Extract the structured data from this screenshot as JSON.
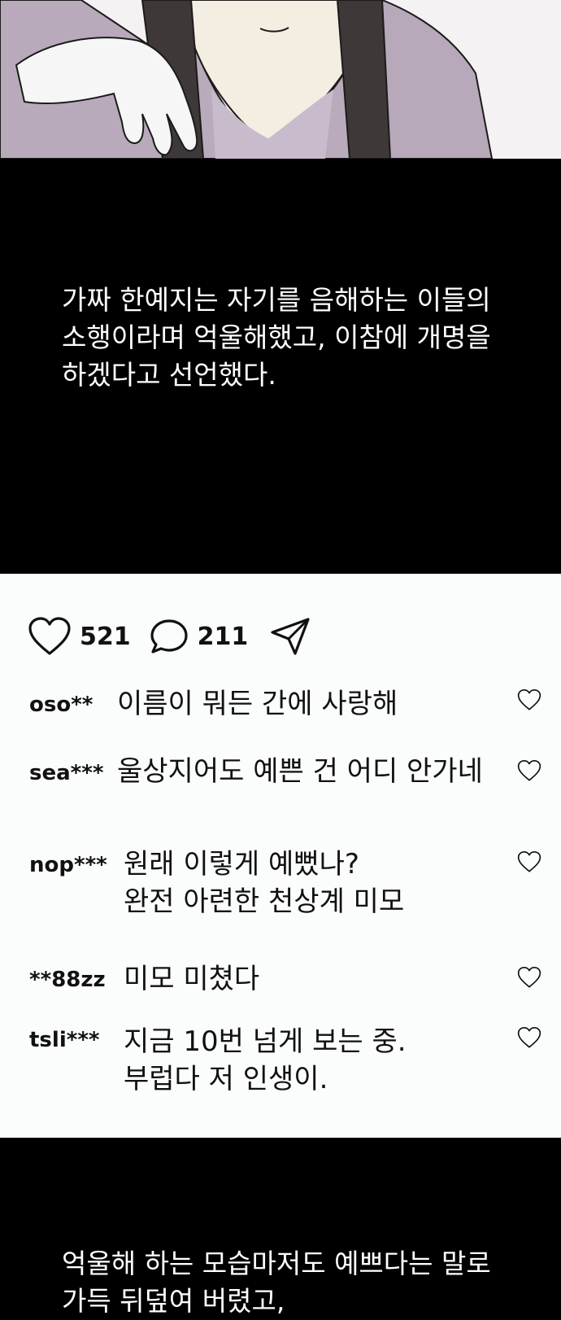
{
  "narration_1": "가짜 한예지는 자기를 음해하는 이들의\n소행이라며 억울해했고, 이참에 개명을\n하겠다고 선언했다.",
  "post": {
    "likes": "521",
    "comments_count": "211",
    "icons": {
      "like": "heart-icon",
      "comment": "speech-bubble-icon",
      "share": "send-icon"
    }
  },
  "comments": [
    {
      "user": "oso**",
      "text": "이름이 뭐든 간에 사랑해"
    },
    {
      "user": "sea***",
      "text": "울상지어도 예쁜 건 어디 안가네"
    },
    {
      "user": "nop***",
      "text": "원래 이렇게 예뻤나?\n완전 아련한 천상계 미모"
    },
    {
      "user": "**88zz",
      "text": "미모 미쳤다"
    },
    {
      "user": "tsli***",
      "text": "지금 10번 넘게 보는 중.\n부럽다 저 인생이."
    }
  ],
  "narration_2": "억울해 하는 모습마저도 예쁘다는 말로\n가득 뒤덮여 버렸고,"
}
